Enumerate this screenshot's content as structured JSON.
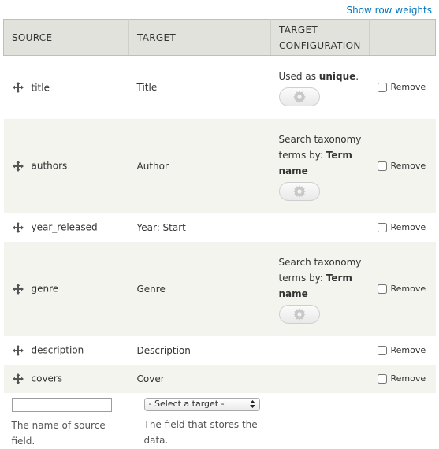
{
  "toolbar": {
    "show_row_weights": "Show row weights"
  },
  "columns": {
    "source": "SOURCE",
    "target": "TARGET",
    "target_config_line1": "TARGET",
    "target_config_line2": "CONFIGURATION"
  },
  "rows": [
    {
      "source": "title",
      "target": "Title",
      "config_prefix": "Used as ",
      "config_bold": "unique",
      "config_suffix": ".",
      "has_gear": true,
      "remove_label": "Remove",
      "remove_checked": false
    },
    {
      "source": "authors",
      "target": "Author",
      "config_prefix": "Search taxonomy terms by: ",
      "config_bold": "Term name",
      "config_suffix": "",
      "has_gear": true,
      "remove_label": "Remove",
      "remove_checked": false
    },
    {
      "source": "year_released",
      "target": "Year: Start",
      "config_prefix": "",
      "config_bold": "",
      "config_suffix": "",
      "has_gear": false,
      "remove_label": "Remove",
      "remove_checked": false
    },
    {
      "source": "genre",
      "target": "Genre",
      "config_prefix": "Search taxonomy terms by: ",
      "config_bold": "Term name",
      "config_suffix": "",
      "has_gear": true,
      "remove_label": "Remove",
      "remove_checked": false
    },
    {
      "source": "description",
      "target": "Description",
      "config_prefix": "",
      "config_bold": "",
      "config_suffix": "",
      "has_gear": false,
      "remove_label": "Remove",
      "remove_checked": false
    },
    {
      "source": "covers",
      "target": "Cover",
      "config_prefix": "",
      "config_bold": "",
      "config_suffix": "",
      "has_gear": false,
      "remove_label": "Remove",
      "remove_checked": false
    }
  ],
  "new_mapping": {
    "source_value": "",
    "source_help": "The name of source field.",
    "target_selected": "- Select a target -",
    "target_help": "The field that stores the data."
  },
  "icons": {
    "drag": "drag-handle-icon",
    "gear": "gear-icon",
    "select_arrows": "updown-arrows-icon"
  },
  "colors": {
    "link": "#0074bd",
    "header_bg": "#e1e2dc",
    "stripe_bg": "#f3f4ee"
  }
}
